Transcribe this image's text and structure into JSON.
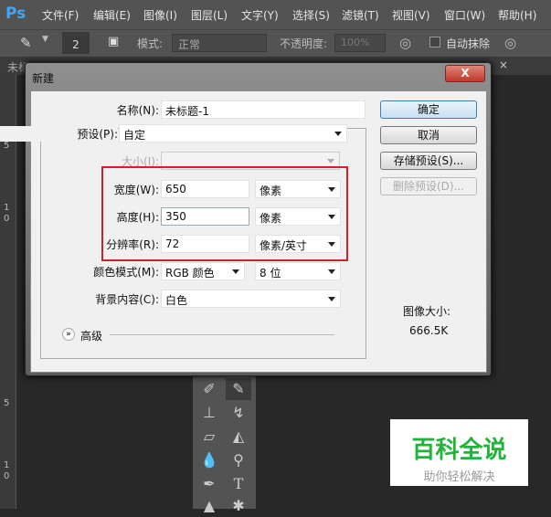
{
  "app": {
    "logo": "Ps"
  },
  "menu": [
    "文件(F)",
    "编辑(E)",
    "图像(I)",
    "图层(L)",
    "文字(Y)",
    "选择(S)",
    "滤镜(T)",
    "视图(V)",
    "窗口(W)",
    "帮助(H)"
  ],
  "options": {
    "brush_size": "2",
    "mode_label": "模式:",
    "mode_value": "正常",
    "opacity_label": "不透明度:",
    "opacity_value": "100%",
    "auto_erase": "自动抹除"
  },
  "tab": {
    "title": "未标",
    "close": "×"
  },
  "ruler": {
    "ticks": [
      "5",
      "1",
      "0",
      "5",
      "1",
      "0"
    ]
  },
  "dialog": {
    "title": "新建",
    "close": "X",
    "name_label": "名称(N):",
    "name_value": "未标题-1",
    "preset_label": "预设(P):",
    "preset_value": "自定",
    "size_label": "大小(I):",
    "width_label": "宽度(W):",
    "width_value": "650",
    "width_unit": "像素",
    "height_label": "高度(H):",
    "height_value": "350",
    "height_unit": "像素",
    "res_label": "分辨率(R):",
    "res_value": "72",
    "res_unit": "像素/英寸",
    "color_label": "颜色模式(M):",
    "color_value": "RGB 颜色",
    "bit_value": "8 位",
    "bg_label": "背景内容(C):",
    "bg_value": "白色",
    "advanced": "高级",
    "buttons": {
      "ok": "确定",
      "cancel": "取消",
      "save": "存储预设(S)...",
      "delete": "删除预设(D)..."
    },
    "image_size_label": "图像大小:",
    "image_size_value": "666.5K",
    "highlight_color": "#d0222a"
  },
  "toolbox": {
    "type_tool": "T"
  },
  "watermark": {
    "title": "百科全说",
    "subtitle": "助你轻松解决",
    "color": "#22b33a"
  }
}
